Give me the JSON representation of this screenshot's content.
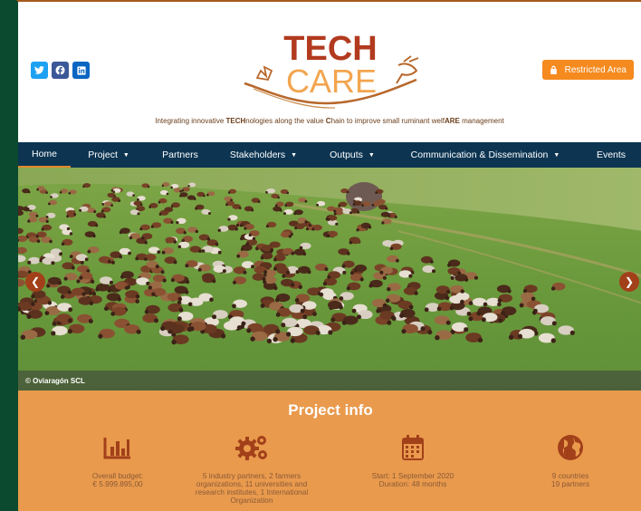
{
  "social": {
    "icons": [
      "twitter-icon",
      "facebook-icon",
      "linkedin-icon"
    ]
  },
  "header": {
    "restricted_label": "Restricted Area",
    "logo_line1": "TECH",
    "logo_line2": "CARE",
    "tagline_parts": [
      "Integrating innovative ",
      "TECH",
      "nologies along the value ",
      "C",
      "hain to improve small ruminant welf",
      "ARE",
      " management"
    ]
  },
  "nav": {
    "items": [
      {
        "label": "Home",
        "dropdown": false,
        "active": true
      },
      {
        "label": "Project",
        "dropdown": true
      },
      {
        "label": "Partners",
        "dropdown": false
      },
      {
        "label": "Stakeholders",
        "dropdown": true
      },
      {
        "label": "Outputs",
        "dropdown": true
      },
      {
        "label": "Communication & Dissemination",
        "dropdown": true
      },
      {
        "label": "Events",
        "dropdown": false
      }
    ]
  },
  "hero": {
    "caption": "© Oviaragón SCL"
  },
  "info": {
    "title": "Project info",
    "cards": [
      {
        "icon": "bar-chart-icon",
        "lines": [
          "Overall budget:",
          "€ 5.999.895,00"
        ]
      },
      {
        "icon": "gears-icon",
        "lines": [
          "5 industry partners, 2 farmers",
          "organizations, 11 universities and",
          "research institutes, 1 International",
          "Organization"
        ]
      },
      {
        "icon": "calendar-icon",
        "lines": [
          "Start: 1 September 2020",
          "Duration: 48 months"
        ]
      },
      {
        "icon": "globe-icon",
        "lines": [
          "9 countries",
          "19 partners"
        ]
      }
    ]
  },
  "colors": {
    "nav_bg": "#0d3552",
    "accent": "#e99a4d",
    "brand_brown": "#a2401a",
    "button_orange": "#f58a1f"
  }
}
